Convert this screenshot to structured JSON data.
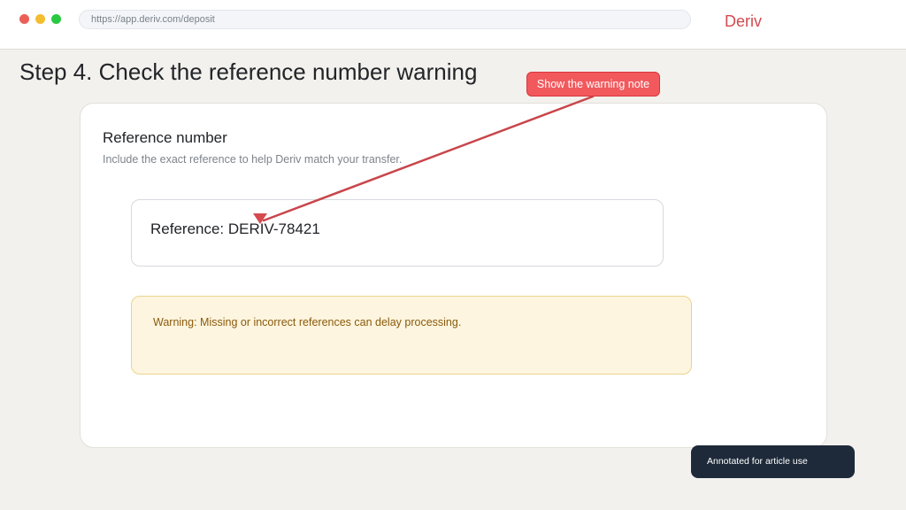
{
  "browser": {
    "url": "https://app.deriv.com/deposit",
    "brand": "Deriv"
  },
  "step": {
    "title": "Step 4. Check the reference number warning"
  },
  "annotation": {
    "callout_label": "Show the warning note",
    "accent_color": "#f1595d",
    "footer_label": "Annotated for article use"
  },
  "card": {
    "title": "Reference number",
    "subtitle": "Include the exact reference to help Deriv match your transfer.",
    "reference": "Reference: DERIV-78421",
    "warning": "Warning: Missing or incorrect references can delay processing."
  }
}
